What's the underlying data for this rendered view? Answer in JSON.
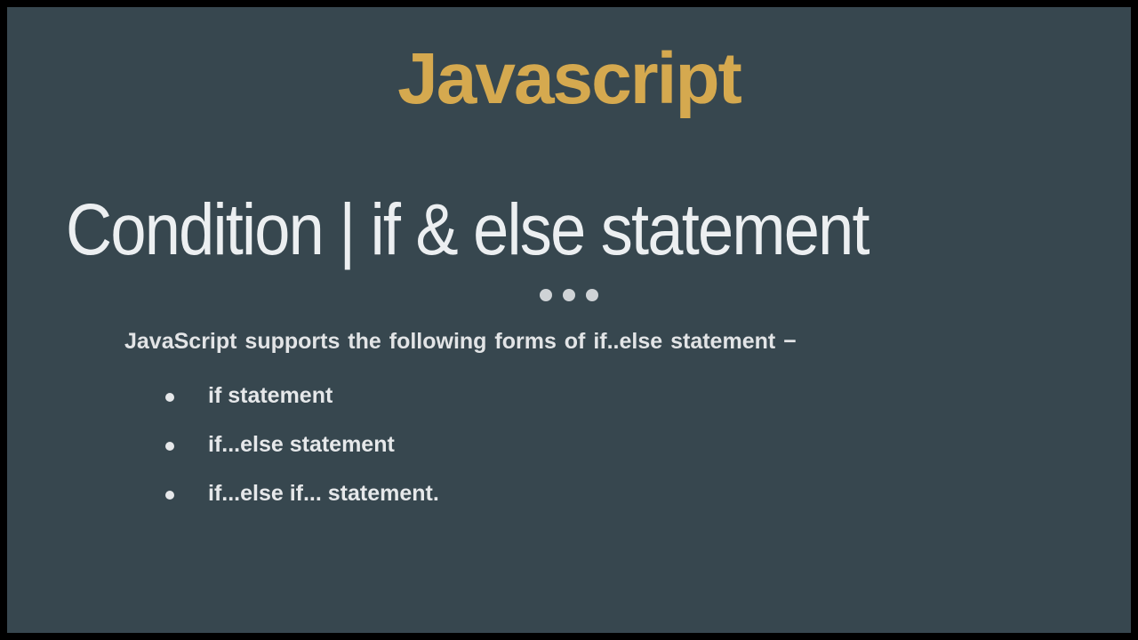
{
  "title": "Javascript",
  "subtitle": "Condition | if & else statement",
  "intro": "JavaScript supports the following forms of if..else statement −",
  "bullets": [
    "if statement",
    "if...else statement",
    "if...else if... statement."
  ]
}
